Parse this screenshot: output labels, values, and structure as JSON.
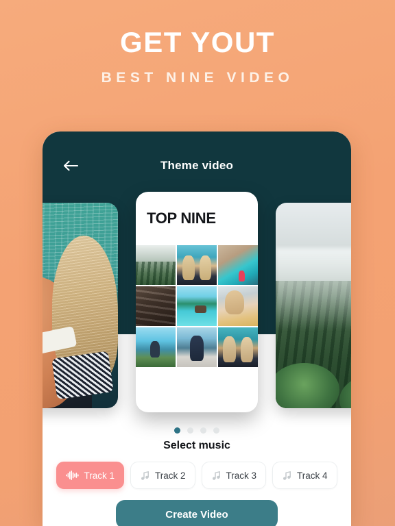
{
  "promo": {
    "title": "GET YOUT",
    "subtitle": "BEST NINE VIDEO"
  },
  "colors": {
    "background_orange": "#f4a273",
    "header_teal": "#11373e",
    "accent_teal": "#3c7d88",
    "active_chip_pink": "#fa8f8f",
    "dot_active": "#2e7385",
    "dot_inactive": "#e2e5e6"
  },
  "appbar": {
    "back_icon": "arrow-left-icon",
    "title": "Theme video"
  },
  "carousel": {
    "cards": [
      {
        "id": "card-left",
        "art": "ocean-beach-photo",
        "selected": false
      },
      {
        "id": "card-center",
        "art": "top-nine-grid",
        "title": "TOP NINE",
        "selected": true
      },
      {
        "id": "card-right",
        "art": "misty-forest-photo",
        "selected": false
      }
    ],
    "grid_cells": [
      "misty-forest",
      "two-friends-beach",
      "turquoise-lagoon",
      "group-on-steps",
      "overwater-bungalow",
      "woman-sunglasses-drink",
      "hiker-umbrella",
      "woman-on-boat",
      "two-women-ocean"
    ],
    "pagination": {
      "count": 4,
      "active_index": 0
    }
  },
  "music": {
    "label": "Select music",
    "tracks": [
      {
        "label": "Track 1",
        "icon": "waveform-icon",
        "active": true
      },
      {
        "label": "Track 2",
        "icon": "music-note-icon",
        "active": false
      },
      {
        "label": "Track 3",
        "icon": "music-note-icon",
        "active": false
      },
      {
        "label": "Track 4",
        "icon": "music-note-icon",
        "active": false
      }
    ]
  },
  "cta": {
    "label": "Create Video"
  }
}
